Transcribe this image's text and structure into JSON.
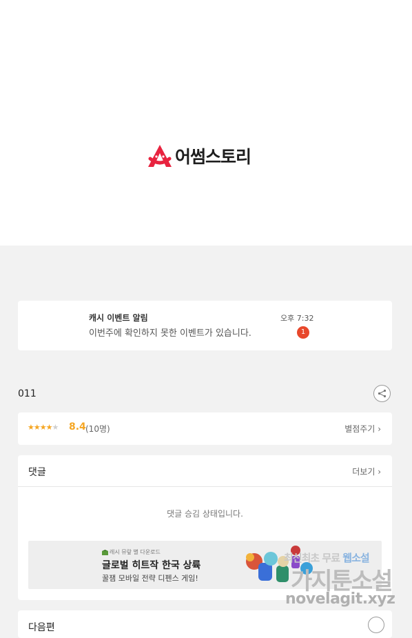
{
  "brand": {
    "name": "어썸스토리",
    "logo_color": "#e8233f"
  },
  "notification": {
    "title": "캐시 이벤트 알림",
    "message": "이번주에 확인하지 못한 이벤트가 있습니다.",
    "time": "오후 7:32",
    "badge": "1"
  },
  "episode": {
    "title": "011",
    "share_icon": "share-icon"
  },
  "rating": {
    "stars_on": "★★★★",
    "stars_off": "★",
    "score": "8.4",
    "count": "(10명)",
    "action": "별점주기"
  },
  "comments": {
    "title": "댓글",
    "more": "더보기",
    "pending": "댓글 승김 상태입니다."
  },
  "ad": {
    "small": "레시 뮤랖 별 다운로드",
    "headline": "글로벌 히트작 한국 상륙",
    "subline": "꿀잼 모바일 전략 디펜스 게임!"
  },
  "next": {
    "title": "다음편"
  },
  "watermark": {
    "line1a": "최신최초 무료",
    "line1b": "웹소설",
    "line2": "가지툰소설",
    "line3": "novelagit.xyz"
  }
}
